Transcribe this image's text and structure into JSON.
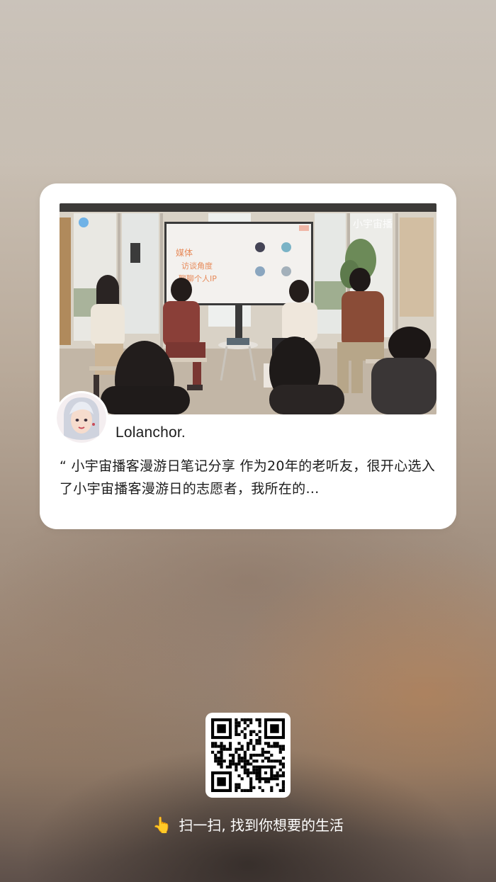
{
  "card": {
    "author": "Lolanchor.",
    "excerpt": "“ 小宇宙播客漫游日笔记分享 作为20年的老听友，很开心选入了小宇宙播客漫游日的志愿者，我所在的…",
    "photo": {
      "watermark": "小宇宙播",
      "screen_lines": [
        "媒体",
        "访谈角度",
        "聊聊个人IP"
      ]
    }
  },
  "qr": {
    "icon": "qr-code"
  },
  "footer": {
    "hand_icon": "pointing-hand-icon",
    "hand_glyph": "👆",
    "scan_text": "扫一扫, 找到你想要的生活"
  },
  "colors": {
    "card_bg": "#ffffff",
    "text": "#1c1c1c",
    "footer_text": "#ffffff"
  }
}
